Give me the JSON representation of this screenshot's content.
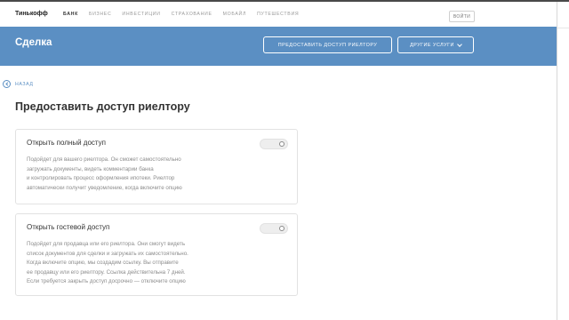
{
  "header": {
    "brand": "Тинькофф",
    "nav": [
      {
        "label": "БАНК",
        "active": true
      },
      {
        "label": "БИЗНЕС",
        "active": false
      },
      {
        "label": "ИНВЕСТИЦИИ",
        "active": false
      },
      {
        "label": "СТРАХОВАНИЕ",
        "active": false
      },
      {
        "label": "МОБАЙЛ",
        "active": false
      },
      {
        "label": "ПУТЕШЕСТВИЯ",
        "active": false
      }
    ],
    "login_label": "ВОЙТИ"
  },
  "hero": {
    "title": "Сделка",
    "realtor_access_button": "ПРЕДОСТАВИТЬ ДОСТУП РИЕЛТОРУ",
    "other_services_button": "ДРУГИЕ УСЛУГИ",
    "other_services_icon": "chevron-down-icon"
  },
  "back": {
    "label": "НАЗАД",
    "icon": "back-arrow-icon"
  },
  "page": {
    "title": "Предоставить доступ риелтору",
    "cards": [
      {
        "title": "Открыть полный доступ",
        "description_lines": [
          "Подойдет для вашего риелтора. Он сможет самостоятельно",
          "загружать документы, видеть комментарии банка",
          "и контролировать процесс оформления ипотеки. Риелтор",
          "автоматически получит уведомление, когда включите опцию"
        ],
        "toggle_on": false
      },
      {
        "title": "Открыть гостевой доступ",
        "description_lines": [
          "Подойдет для продавца или его риелтора. Они смогут видеть",
          "список документов для сделки и загружать их самостоятельно.",
          "Когда включите опцию, мы создадим ссылку. Вы отправите",
          "ее продавцу или его риелтору. Ссылка действительна 7 дней.",
          "Если требуется закрыть доступ досрочно — отключите опцию"
        ],
        "toggle_on": false
      }
    ]
  },
  "colors": {
    "hero_background": "#5b8fc3",
    "link_accent": "#5b8fc3",
    "muted_text": "#8c8c8c",
    "card_border": "#e2e2e2"
  }
}
